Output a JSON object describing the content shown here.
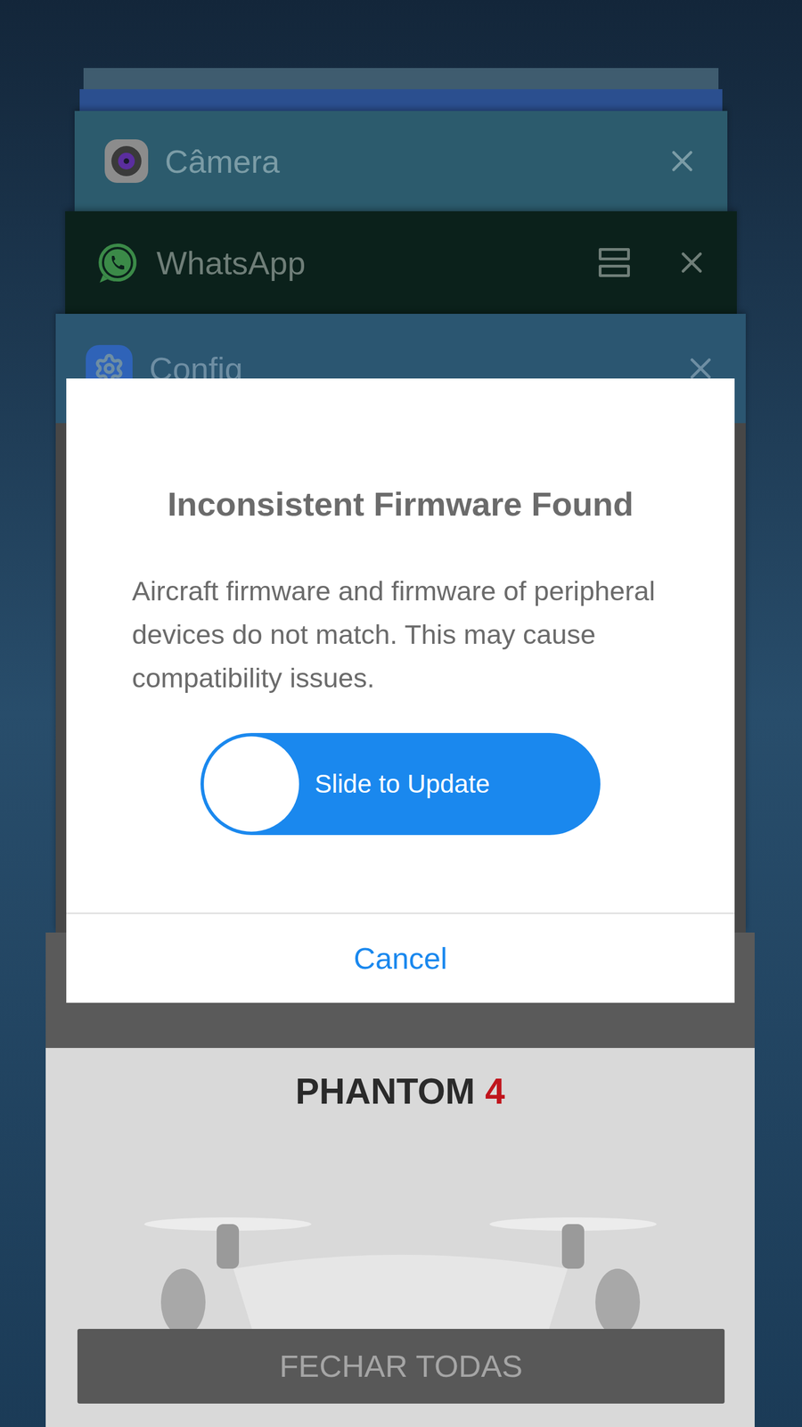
{
  "recent_apps": [
    {
      "title": "Câmera",
      "kind": "camera",
      "split_screen": false
    },
    {
      "title": "WhatsApp",
      "kind": "whatsapp",
      "split_screen": true
    },
    {
      "title": "Config",
      "kind": "settings",
      "split_screen": false
    }
  ],
  "background_app": {
    "logo_text": "PHANTOM",
    "logo_number": "4"
  },
  "dialog": {
    "title": "Inconsistent Firmware Found",
    "message": "Aircraft firmware and firmware of peripheral devices do not match. This may cause compatibility issues.",
    "slider": {
      "label": "Slide to Update",
      "level": 0
    },
    "cancel_button": "Cancel"
  },
  "close_all_button": "FECHAR TODAS"
}
